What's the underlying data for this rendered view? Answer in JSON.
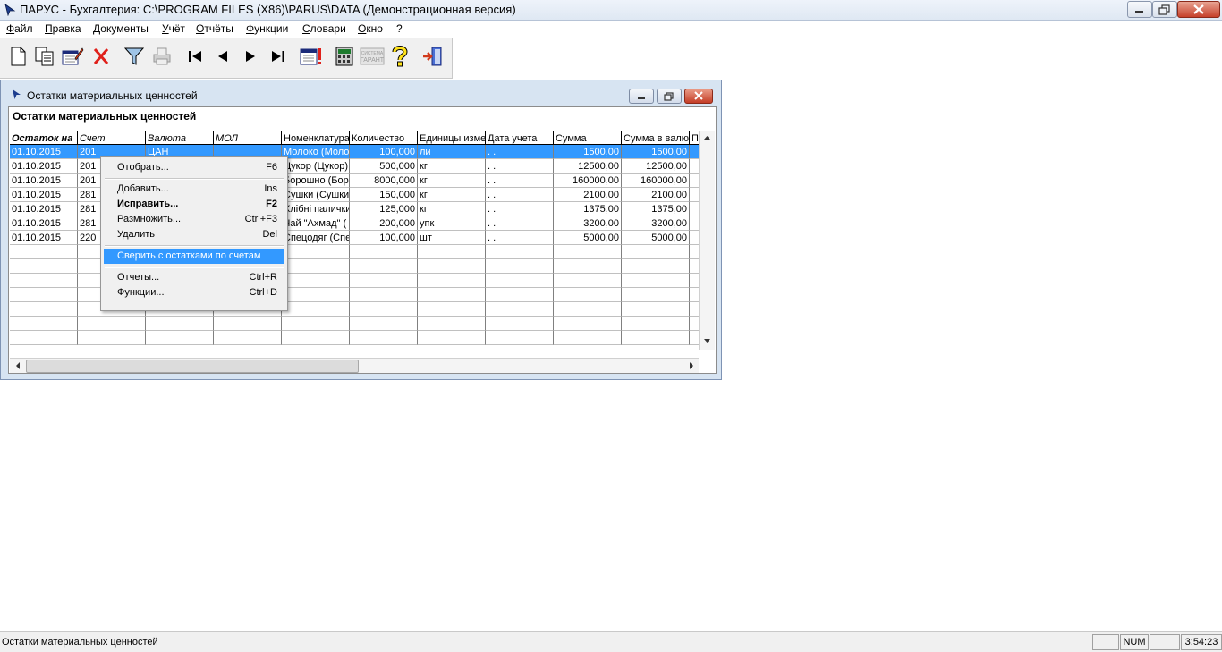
{
  "app": {
    "title": "ПАРУС - Бухгалтерия: C:\\PROGRAM FILES (X86)\\PARUS\\DATA (Демонстрационная версия)"
  },
  "menu": [
    "Файл",
    "Правка",
    "Документы",
    "Учёт",
    "Отчёты",
    "Функции",
    "Словари",
    "Окно",
    "?"
  ],
  "toolbar": {
    "icons": [
      "new-doc-icon",
      "copy-doc-icon",
      "edit-doc-icon",
      "delete-icon",
      "filter-icon",
      "print-icon",
      "first-record-icon",
      "prev-record-icon",
      "next-record-icon",
      "last-record-icon",
      "calendar-alert-icon",
      "calculator-icon",
      "garant-icon",
      "help-icon",
      "exit-icon"
    ],
    "garant_label": "СИСТЕМА ГАРАНТ"
  },
  "window": {
    "title": "Остатки материальных ценностей",
    "panel_title": "Остатки материальных ценностей"
  },
  "table": {
    "columns": [
      "Остаток на",
      "Счет",
      "Валюта",
      "МОЛ",
      "Номенклатура",
      "Количество",
      "Единицы изме",
      "Дата учета",
      "Сумма",
      "Сумма в валют",
      "П"
    ],
    "rows": [
      [
        "01.10.2015",
        "201",
        "ЦАН",
        "",
        "Молоко (Моло",
        "100,000",
        "ли",
        " .  .",
        "1500,00",
        "1500,00"
      ],
      [
        "01.10.2015",
        "201",
        "",
        "",
        "Цукор (Цукор)",
        "500,000",
        "кг",
        " .  .",
        "12500,00",
        "12500,00"
      ],
      [
        "01.10.2015",
        "201",
        "",
        "",
        "Борошно (Бор",
        "8000,000",
        "кг",
        " .  .",
        "160000,00",
        "160000,00"
      ],
      [
        "01.10.2015",
        "281",
        "",
        "",
        "Сушки (Сушки",
        "150,000",
        "кг",
        " .  .",
        "2100,00",
        "2100,00"
      ],
      [
        "01.10.2015",
        "281",
        "",
        "",
        "Хлібні палички",
        "125,000",
        "кг",
        " .  .",
        "1375,00",
        "1375,00"
      ],
      [
        "01.10.2015",
        "281",
        "",
        "",
        "Чай \"Ахмад\" (",
        "200,000",
        "упк",
        " .  .",
        "3200,00",
        "3200,00"
      ],
      [
        "01.10.2015",
        "220",
        "",
        "",
        "Спецодяг (Спе",
        "100,000",
        "шт",
        " .  .",
        "5000,00",
        "5000,00"
      ]
    ],
    "selected_row": 0
  },
  "context_menu": {
    "items": [
      {
        "label": "Отобрать...",
        "shortcut": "F6"
      },
      {
        "label": "Добавить...",
        "shortcut": "Ins"
      },
      {
        "label": "Исправить...",
        "shortcut": "F2",
        "bold": true
      },
      {
        "label": "Размножить...",
        "shortcut": "Ctrl+F3"
      },
      {
        "label": "Удалить",
        "shortcut": "Del"
      },
      {
        "label": "Сверить с остатками по счетам",
        "shortcut": "",
        "highlighted": true
      },
      {
        "label": "Отчеты...",
        "shortcut": "Ctrl+R"
      },
      {
        "label": "Функции...",
        "shortcut": "Ctrl+D"
      }
    ]
  },
  "status": {
    "text": "Остатки материальных ценностей",
    "num": "NUM",
    "time": "3:54:23"
  }
}
